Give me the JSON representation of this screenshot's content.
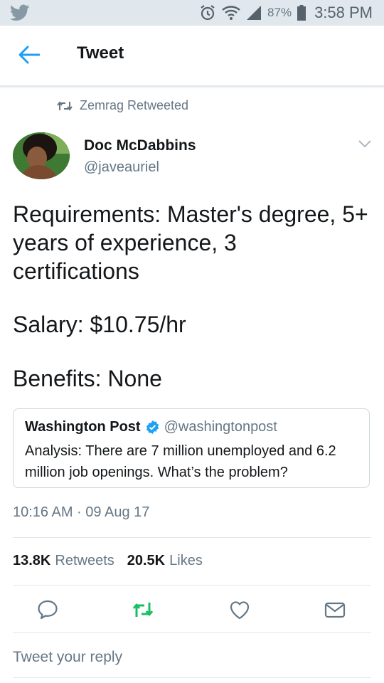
{
  "status_bar": {
    "battery": "87%",
    "time": "3:58 PM"
  },
  "header": {
    "title": "Tweet"
  },
  "retweet_context": {
    "text": "Zemrag Retweeted"
  },
  "author": {
    "name": "Doc McDabbins",
    "handle": "@javeauriel"
  },
  "tweet": {
    "lines": [
      "Requirements: Master's degree, 5+ years of experience, 3 certifications",
      "Salary: $10.75/hr",
      "Benefits: None"
    ]
  },
  "quoted": {
    "name": "Washington Post",
    "handle": "@washingtonpost",
    "text": "Analysis: There are 7 million unemployed and 6.2 million job openings. What’s the problem?"
  },
  "timestamp": "10:16 AM · 09 Aug 17",
  "stats": {
    "retweets_count": "13.8K",
    "retweets_label": "Retweets",
    "likes_count": "20.5K",
    "likes_label": "Likes"
  },
  "actions": {
    "icons": [
      "reply-icon",
      "retweet-icon",
      "like-icon",
      "message-icon"
    ]
  },
  "reply": {
    "placeholder": "Tweet your reply"
  },
  "colors": {
    "accent": "#1da1f2",
    "retweet_green": "#17bf63",
    "muted": "#657786",
    "status_bar": "#e1e8ed"
  }
}
